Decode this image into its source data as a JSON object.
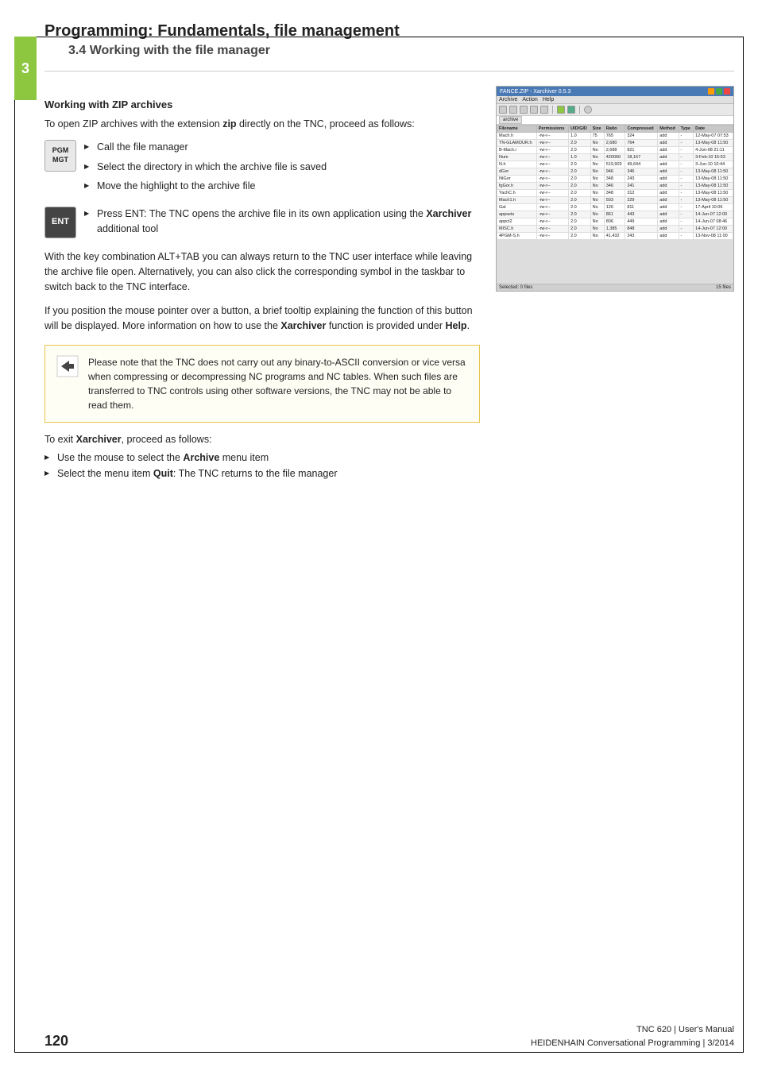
{
  "page": {
    "chapter_number": "3",
    "main_title": "Programming: Fundamentals, file management",
    "sub_title": "3.4   Working with the file manager",
    "page_number": "120",
    "footer_right_line1": "TNC 620 | User's Manual",
    "footer_right_line2": "HEIDENHAIN Conversational Programming | 3/2014"
  },
  "section": {
    "heading": "Working with ZIP archives",
    "intro": "To open ZIP archives with the extension zip directly on the TNC, proceed as follows:"
  },
  "key_pgm": "PGM\nMGT",
  "key_ent": "ENT",
  "steps_group1": [
    "Call the file manager",
    "Select the directory in which the archive file is saved",
    "Move the highlight to the archive file"
  ],
  "steps_group2": [
    "Press ENT: The TNC opens the archive file in its own application using the Xarchiver additional tool"
  ],
  "body_para1": "With the key combination ALT+TAB you can always return to the TNC user interface while leaving the archive file open. Alternatively, you can also click the corresponding symbol in the taskbar to switch back to the TNC interface.",
  "body_para2": "If you position the mouse pointer over a button, a brief tooltip explaining the function of this button will be displayed. More information on how to use the Xarchiver function is provided under Help.",
  "note_text": "Please note that the TNC does not carry out any binary-to-ASCII conversion or vice versa when compressing or decompressing NC programs and NC tables. When such files are transferred to TNC controls using other software versions, the TNC may not be able to read them.",
  "exit_intro": "To exit Xarchiver, proceed as follows:",
  "exit_steps": [
    "Use the mouse to select the Archive menu item",
    "Select the menu item Quit: The TNC returns to the file manager"
  ],
  "screenshot": {
    "title": "FANCE.ZIP - Xarchiver 0.5.3",
    "menu_items": [
      "Archive",
      "Action",
      "Help"
    ],
    "columns": [
      "Filename",
      "Permissions",
      "UID/GID",
      "Size",
      "Ratio",
      "Compressed",
      "Method",
      "Type",
      "Date"
    ],
    "rows": [
      [
        "Mach.h",
        "-rw-r--",
        "1.0",
        "75",
        "765",
        "324",
        "add",
        "-",
        "12-May-07 07:53"
      ],
      [
        "TN-GLAMOUR.h",
        "-rw-r--",
        "2.0",
        "No",
        "2,680",
        "764",
        "add",
        "-",
        "13-May-08 11:50"
      ],
      [
        "B-Mach.i",
        "-rw-r--",
        "2.0",
        "No",
        "2,688",
        "821",
        "add",
        "-",
        "4-Jun-08 21:11"
      ],
      [
        "Num",
        "-rw-r--",
        "1.0",
        "No",
        "420060",
        "18,167",
        "add",
        "-",
        "3-Feb-10 15:53"
      ],
      [
        "N.h",
        "-rw-r--",
        "2.0",
        "No",
        "519,903",
        "49,644",
        "add",
        "-",
        "3-Jun-10 10:44"
      ],
      [
        "dGor",
        "-rw-r--",
        "2.0",
        "No",
        "946",
        "346",
        "add",
        "-",
        "13-May-08 11:50"
      ],
      [
        "NtGor",
        "-rw-r--",
        "2.0",
        "No",
        "348",
        "243",
        "add",
        "-",
        "13-May-08 11:50"
      ],
      [
        "fgGor.h",
        "-rw-r--",
        "2.0",
        "No",
        "346",
        "241",
        "add",
        "-",
        "13-May-08 11:50"
      ],
      [
        "YachC.h",
        "-rw-r--",
        "2.0",
        "No",
        "348",
        "312",
        "add",
        "-",
        "13-May-08 11:50"
      ],
      [
        "Mach1.h",
        "-rw-r--",
        "2.0",
        "No",
        "503",
        "229",
        "add",
        "-",
        "13-May-08 11:50"
      ],
      [
        "Gal",
        "-rw-r--",
        "2.0",
        "No",
        "126",
        "811",
        "add",
        "-",
        "17-April 10:06"
      ],
      [
        "appsets",
        "-rw-r--",
        "2.0",
        "No",
        "861",
        "443",
        "add",
        "-",
        "14-Jun-07 12:00"
      ],
      [
        "appct2",
        "-rw-r--",
        "2.0",
        "No",
        "806",
        "449",
        "add",
        "-",
        "14-Jun-07 08:46"
      ],
      [
        "MISC.h",
        "-rw-r--",
        "2.0",
        "No",
        "1,385",
        "848",
        "add",
        "-",
        "14-Jun-07 12:00"
      ],
      [
        "4PGM-S.h",
        "-rw-r--",
        "2.0",
        "No",
        "41,432",
        "243",
        "add",
        "-",
        "13-Nov-08 11:00"
      ]
    ],
    "statusbar": "Selected: 0 files"
  }
}
